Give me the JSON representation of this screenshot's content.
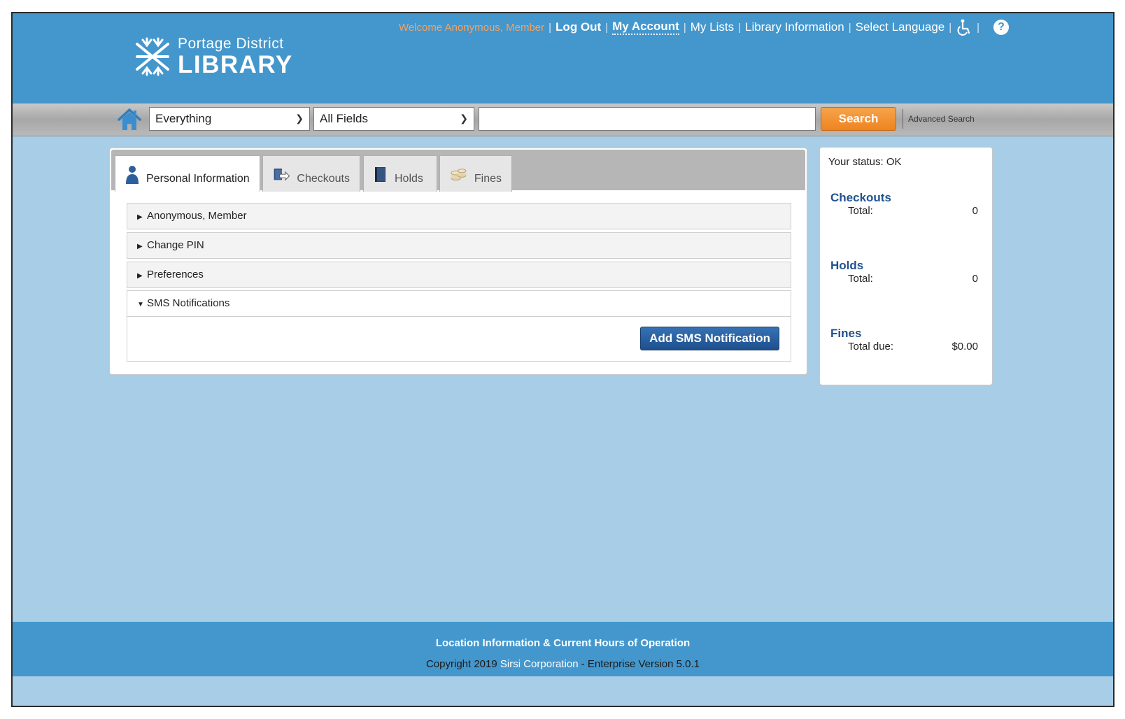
{
  "header": {
    "logo_line1": "Portage District",
    "logo_line2": "LIBRARY",
    "welcome": "Welcome Anonymous, Member",
    "nav": {
      "logout": "Log Out",
      "my_account": "My Account",
      "my_lists": "My Lists",
      "library_info": "Library Information",
      "select_language": "Select Language"
    },
    "help_glyph": "?"
  },
  "search": {
    "scope_value": "Everything",
    "field_value": "All Fields",
    "query_value": "",
    "button_label": "Search",
    "advanced_label": "Advanced Search"
  },
  "tabs": [
    {
      "label": "Personal Information",
      "icon": "person-icon",
      "active": true
    },
    {
      "label": "Checkouts",
      "icon": "checkouts-icon",
      "active": false
    },
    {
      "label": "Holds",
      "icon": "book-icon",
      "active": false
    },
    {
      "label": "Fines",
      "icon": "coins-icon",
      "active": false
    }
  ],
  "accordion": [
    {
      "label": "Anonymous, Member",
      "expanded": false
    },
    {
      "label": "Change PIN",
      "expanded": false
    },
    {
      "label": "Preferences",
      "expanded": false
    },
    {
      "label": "SMS Notifications",
      "expanded": true
    }
  ],
  "sms": {
    "add_label": "Add SMS Notification"
  },
  "status": {
    "text": "Your status: OK",
    "checkouts": {
      "heading": "Checkouts",
      "label": "Total:",
      "value": "0"
    },
    "holds": {
      "heading": "Holds",
      "label": "Total:",
      "value": "0"
    },
    "fines": {
      "heading": "Fines",
      "label": "Total due:",
      "value": "$0.00"
    }
  },
  "footer": {
    "line1": "Location Information & Current Hours of Operation",
    "copyright_prefix": "Copyright 2019 ",
    "company": "Sirsi Corporation",
    "version": " - Enterprise Version 5.0.1"
  },
  "colors": {
    "header_blue": "#4497cd",
    "background": "#a8cde6",
    "search_orange": "#ee8420",
    "button_blue": "#1e4f8c",
    "status_heading": "#1f5290",
    "welcome_orange": "#f4a261"
  }
}
